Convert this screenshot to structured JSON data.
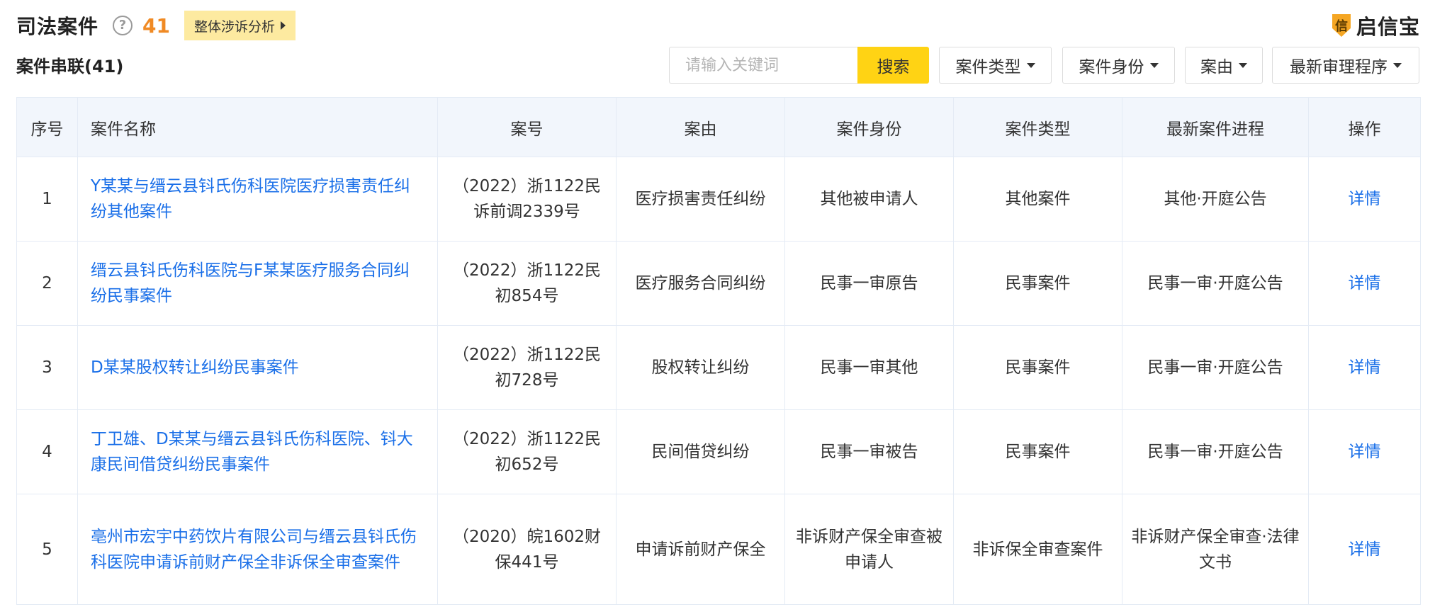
{
  "header": {
    "title": "司法案件",
    "help_icon": "question-circle-icon",
    "total_count": "41",
    "analysis_button": "整体涉诉分析",
    "brand_icon_glyph": "信",
    "brand_name": "启信宝"
  },
  "subtitle": "案件串联(41)",
  "toolbar": {
    "search_placeholder": "请输入关键词",
    "search_value": "",
    "search_button": "搜索",
    "filters": [
      "案件类型",
      "案件身份",
      "案由",
      "最新审理程序"
    ]
  },
  "table": {
    "columns": [
      "序号",
      "案件名称",
      "案号",
      "案由",
      "案件身份",
      "案件类型",
      "最新案件进程",
      "操作"
    ],
    "rows": [
      {
        "index": "1",
        "name": "Y某某与缙云县钭氏伤科医院医疗损害责任纠纷其他案件",
        "case_no": "（2022）浙1122民诉前调2339号",
        "cause": "医疗损害责任纠纷",
        "identity": "其他被申请人",
        "type": "其他案件",
        "progress": "其他·开庭公告",
        "action": "详情"
      },
      {
        "index": "2",
        "name": "缙云县钭氏伤科医院与F某某医疗服务合同纠纷民事案件",
        "case_no": "（2022）浙1122民初854号",
        "cause": "医疗服务合同纠纷",
        "identity": "民事一审原告",
        "type": "民事案件",
        "progress": "民事一审·开庭公告",
        "action": "详情"
      },
      {
        "index": "3",
        "name": "D某某股权转让纠纷民事案件",
        "case_no": "（2022）浙1122民初728号",
        "cause": "股权转让纠纷",
        "identity": "民事一审其他",
        "type": "民事案件",
        "progress": "民事一审·开庭公告",
        "action": "详情"
      },
      {
        "index": "4",
        "name": "丁卫雄、D某某与缙云县钭氏伤科医院、钭大康民间借贷纠纷民事案件",
        "case_no": "（2022）浙1122民初652号",
        "cause": "民间借贷纠纷",
        "identity": "民事一审被告",
        "type": "民事案件",
        "progress": "民事一审·开庭公告",
        "action": "详情"
      },
      {
        "index": "5",
        "name": "亳州市宏宇中药饮片有限公司与缙云县钭氏伤科医院申请诉前财产保全非诉保全审查案件",
        "case_no": "（2020）皖1602财保441号",
        "cause": "申请诉前财产保全",
        "identity": "非诉财产保全审查被申请人",
        "type": "非诉保全审查案件",
        "progress": "非诉财产保全审查·法律文书",
        "action": "详情"
      }
    ]
  },
  "colors": {
    "accent_yellow": "#ffd314",
    "count_orange": "#f08a24",
    "link_blue": "#1a6fe8",
    "header_bg": "#f2f6fc"
  }
}
